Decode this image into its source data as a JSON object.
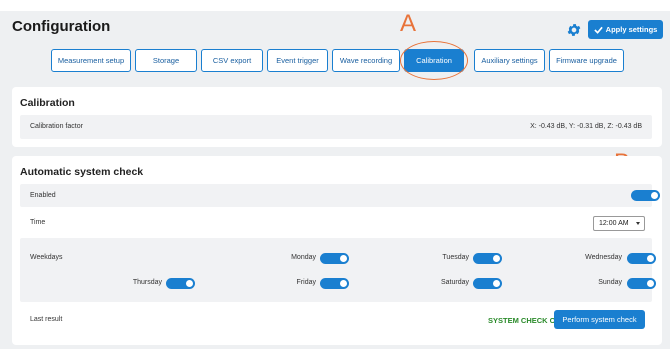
{
  "header": {
    "title": "Configuration",
    "apply_label": "Apply settings"
  },
  "tabs": [
    {
      "label": "Measurement setup",
      "active": false
    },
    {
      "label": "Storage",
      "active": false
    },
    {
      "label": "CSV export",
      "active": false
    },
    {
      "label": "Event trigger",
      "active": false
    },
    {
      "label": "Wave recording",
      "active": false
    },
    {
      "label": "Calibration",
      "active": true
    },
    {
      "label": "Auxiliary settings",
      "active": false
    },
    {
      "label": "Firmware upgrade",
      "active": false
    }
  ],
  "annotations": {
    "a": "A",
    "b": "B"
  },
  "calibration": {
    "title": "Calibration",
    "factor_label": "Calibration factor",
    "factor_value": "X: -0.43 dB, Y: -0.31 dB, Z: -0.43 dB"
  },
  "system_check": {
    "title": "Automatic system check",
    "enabled_label": "Enabled",
    "enabled": true,
    "time_label": "Time",
    "time_value": "12:00 AM",
    "weekdays_label": "Weekdays",
    "days": [
      {
        "label": "Monday",
        "on": true
      },
      {
        "label": "Tuesday",
        "on": true
      },
      {
        "label": "Wednesday",
        "on": true
      },
      {
        "label": "Thursday",
        "on": true
      },
      {
        "label": "Friday",
        "on": true
      },
      {
        "label": "Saturday",
        "on": true
      },
      {
        "label": "Sunday",
        "on": true
      }
    ],
    "last_result_label": "Last result",
    "last_result_value": "SYSTEM CHECK OK",
    "perform_label": "Perform system check"
  },
  "colors": {
    "accent": "#1a7fd0",
    "ok": "#2a8a2a",
    "annotation": "#e8733a"
  }
}
